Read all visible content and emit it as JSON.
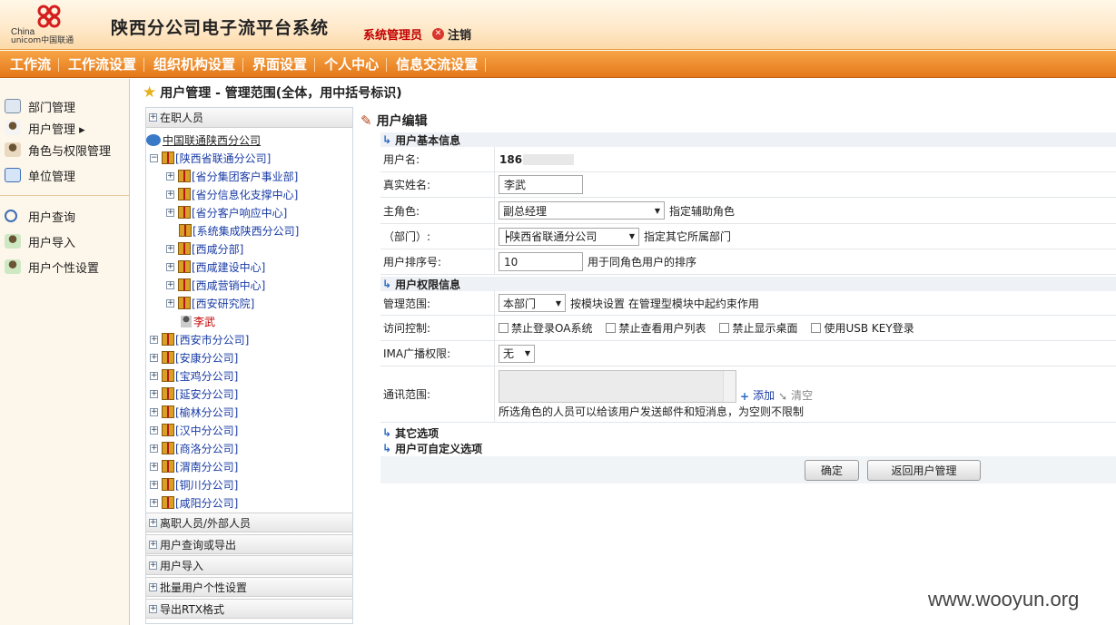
{
  "header": {
    "logo_line1": "China",
    "logo_line2": "unicom中国联通",
    "app_title": "陕西分公司电子流平台系统",
    "role": "系统管理员",
    "logout": "注销"
  },
  "nav": [
    "工作流",
    "工作流设置",
    "组织机构设置",
    "界面设置",
    "个人中心",
    "信息交流设置"
  ],
  "sidebar": {
    "group1": [
      {
        "label": "部门管理",
        "icon": "department-icon"
      },
      {
        "label": "用户管理 ▸",
        "icon": "user-icon"
      },
      {
        "label": "角色与权限管理",
        "icon": "role-icon"
      },
      {
        "label": "单位管理",
        "icon": "home-icon"
      }
    ],
    "group2": [
      {
        "label": "用户查询",
        "icon": "search-icon"
      },
      {
        "label": "用户导入",
        "icon": "import-icon"
      },
      {
        "label": "用户个性设置",
        "icon": "user-settings-icon"
      }
    ]
  },
  "page_title": "用户管理 - 管理范围(全体，用中括号标识)",
  "tree": {
    "top_bar": "在职人员",
    "root": "中国联通陕西分公司",
    "province": "[陕西省联通分公司]",
    "children": [
      "[省分集团客户事业部]",
      "[省分信息化支撑中心]",
      "[省分客户响应中心]",
      "[系统集成陕西分公司]",
      "[西咸分部]",
      "[西咸建设中心]",
      "[西咸营销中心]",
      "[西安研究院]"
    ],
    "user": "李武",
    "branches": [
      "[西安市分公司]",
      "[安康分公司]",
      "[宝鸡分公司]",
      "[延安分公司]",
      "[榆林分公司]",
      "[汉中分公司]",
      "[商洛分公司]",
      "[渭南分公司]",
      "[铜川分公司]",
      "[咸阳分公司]"
    ],
    "bottom_bars": [
      "离职人员/外部人员",
      "用户查询或导出",
      "用户导入",
      "批量用户个性设置",
      "导出RTX格式"
    ]
  },
  "editor": {
    "title": "用户编辑",
    "section_basic": "用户基本信息",
    "username_label": "用户名:",
    "username_value": "186",
    "realname_label": "真实姓名:",
    "realname_value": "李武",
    "role_label": "主角色:",
    "role_value": "副总经理",
    "role_link": "指定辅助角色",
    "dept_label": "（部门）:",
    "dept_value": "┝陕西省联通分公司",
    "dept_link": "指定其它所属部门",
    "order_label": "用户排序号:",
    "order_value": "10",
    "order_hint": "用于同角色用户的排序",
    "section_perm": "用户权限信息",
    "scope_label": "管理范围:",
    "scope_value": "本部门",
    "scope_hint": "按模块设置 在管理型模块中起约束作用",
    "access_label": "访问控制:",
    "access_options": [
      "禁止登录OA系统",
      "禁止查看用户列表",
      "禁止显示桌面",
      "使用USB KEY登录"
    ],
    "ima_label": "IMA广播权限:",
    "ima_value": "无",
    "contact_label": "通讯范围:",
    "contact_add": "添加",
    "contact_clear": "清空",
    "contact_hint": "所选角色的人员可以给该用户发送邮件和短消息，为空则不限制",
    "section_other": "其它选项",
    "section_custom": "用户可自定义选项",
    "ok": "确定",
    "back": "返回用户管理"
  },
  "watermark": "www.wooyun.org"
}
